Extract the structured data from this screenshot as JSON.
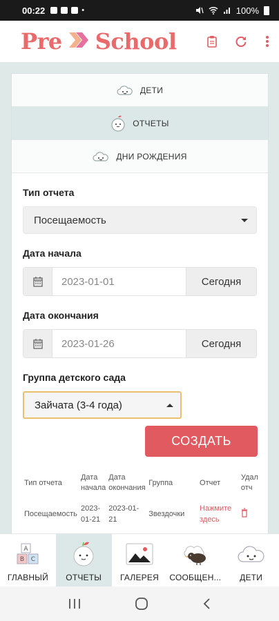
{
  "status_bar": {
    "time": "00:22",
    "dot": "•",
    "battery": "100%"
  },
  "app": {
    "logo_left": "Pre",
    "logo_right": "School",
    "icons": [
      "clipboard-icon",
      "refresh-icon",
      "more-vert-icon"
    ],
    "accent_color": "#e05a5f"
  },
  "tabs": [
    {
      "label": "ДЕТИ",
      "icon": "cloud-face-icon",
      "active": false
    },
    {
      "label": "ОТЧЕТЫ",
      "icon": "apple-face-icon",
      "active": true
    },
    {
      "label": "ДНИ РОЖДЕНИЯ",
      "icon": "cloud-face-icon",
      "active": false
    }
  ],
  "form": {
    "report_type_label": "Тип отчета",
    "report_type_value": "Посещаемость",
    "start_label": "Дата начала",
    "start_value": "2023-01-01",
    "start_today": "Сегодня",
    "end_label": "Дата окончания",
    "end_value": "2023-01-26",
    "end_today": "Сегодня",
    "group_label": "Группа детского сада",
    "group_value": "Зайчата (3-4 года)",
    "create_button": "СОЗДАТЬ"
  },
  "table": {
    "headers": [
      "Тип отчета",
      "Дата начала",
      "Дата окончания",
      "Группа",
      "Отчет",
      "Удал отч"
    ],
    "rows": [
      [
        "Посещаемость",
        "2023-01-21",
        "2023-01-21",
        "Звездочки",
        "Нажмите здесь",
        ""
      ]
    ]
  },
  "bottom_nav": [
    {
      "label": "ГЛАВНЫЙ",
      "icon": "abc-blocks-icon",
      "active": false
    },
    {
      "label": "ОТЧЕТЫ",
      "icon": "apple-face-icon",
      "active": true
    },
    {
      "label": "ГАЛЕРЕЯ",
      "icon": "picture-icon",
      "active": false
    },
    {
      "label": "СООБЩЕН...",
      "icon": "bird-icon",
      "active": false
    },
    {
      "label": "ДЕТИ",
      "icon": "cloud-face-icon",
      "active": false
    }
  ],
  "system_nav": [
    "recents-icon",
    "home-icon",
    "back-icon"
  ]
}
